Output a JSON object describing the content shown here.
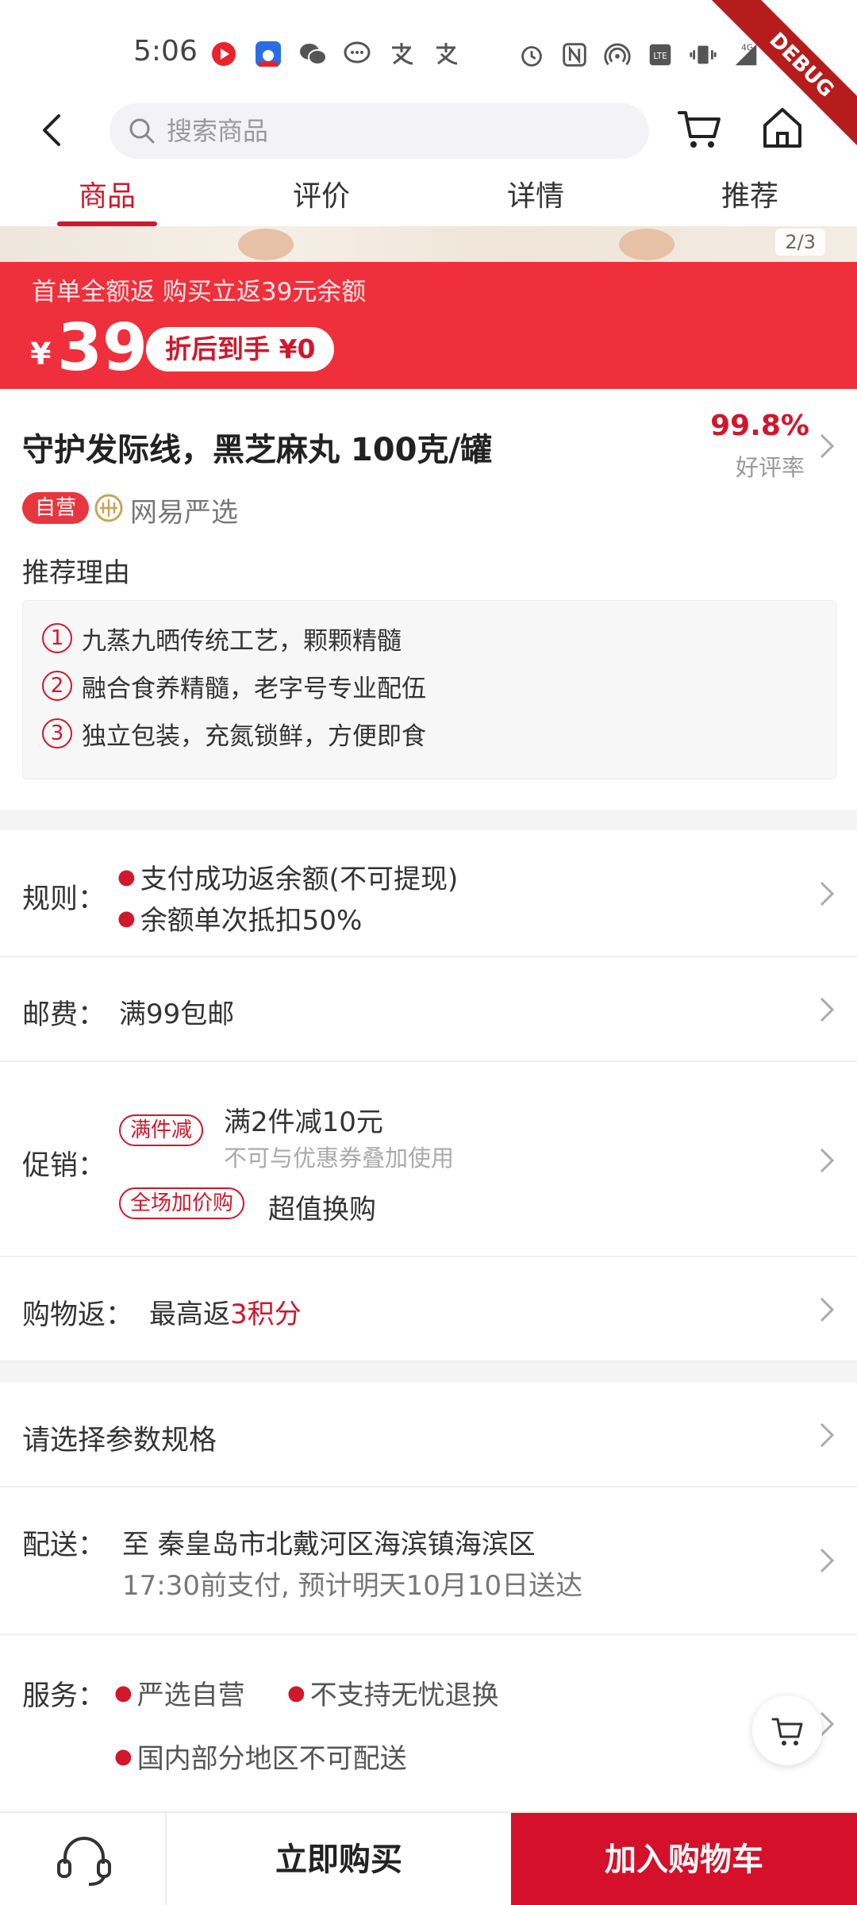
{
  "status_bar": {
    "time": "5:06",
    "network": "4G",
    "ribbon": "DEBUG"
  },
  "search": {
    "placeholder": "搜索商品"
  },
  "tabs": [
    {
      "label": "商品",
      "active": true
    },
    {
      "label": "评价",
      "active": false
    },
    {
      "label": "详情",
      "active": false
    },
    {
      "label": "推荐",
      "active": false
    }
  ],
  "hero": {
    "counter": "2/3"
  },
  "price_banner": {
    "promo": "首单全额返 购买立返39元余额",
    "currency": "¥",
    "price": "39",
    "after_discount": "折后到手 ¥0"
  },
  "product": {
    "title": "守护发际线，黑芝麻丸 100克/罐",
    "rating_value": "99.8%",
    "rating_label": "好评率",
    "self_tag": "自营",
    "brand": "网易严选",
    "reason_title": "推荐理由",
    "reasons": [
      {
        "num": "1",
        "text": "九蒸九晒传统工艺，颗颗精髓"
      },
      {
        "num": "2",
        "text": "融合食养精髓，老字号专业配伍"
      },
      {
        "num": "3",
        "text": "独立包装，充氮锁鲜，方便即食"
      }
    ]
  },
  "rules": {
    "label": "规则：",
    "items": [
      "支付成功返余额(不可提现)",
      "余额单次抵扣50%"
    ]
  },
  "shipping": {
    "label": "邮费：",
    "value": "满99包邮"
  },
  "promotion": {
    "label": "促销：",
    "tag1": "满件减",
    "main1": "满2件减10元",
    "sub1": "不可与优惠券叠加使用",
    "tag2": "全场加价购",
    "main2": "超值换购"
  },
  "cashback": {
    "label": "购物返：",
    "prefix": "最高返",
    "highlight": "3积分"
  },
  "spec": {
    "label": "请选择参数规格"
  },
  "delivery": {
    "label": "配送：",
    "address": "至 秦皇岛市北戴河区海滨镇海滨区",
    "eta": "17:30前支付, 预计明天10月10日送达"
  },
  "service": {
    "label": "服务：",
    "items": [
      "严选自营",
      "不支持无忧退换",
      "国内部分地区不可配送"
    ]
  },
  "bottom_bar": {
    "buy_now": "立即购买",
    "add_to_cart": "加入购物车"
  },
  "colors": {
    "accent": "#d0172c",
    "banner": "#ef2f3b"
  }
}
